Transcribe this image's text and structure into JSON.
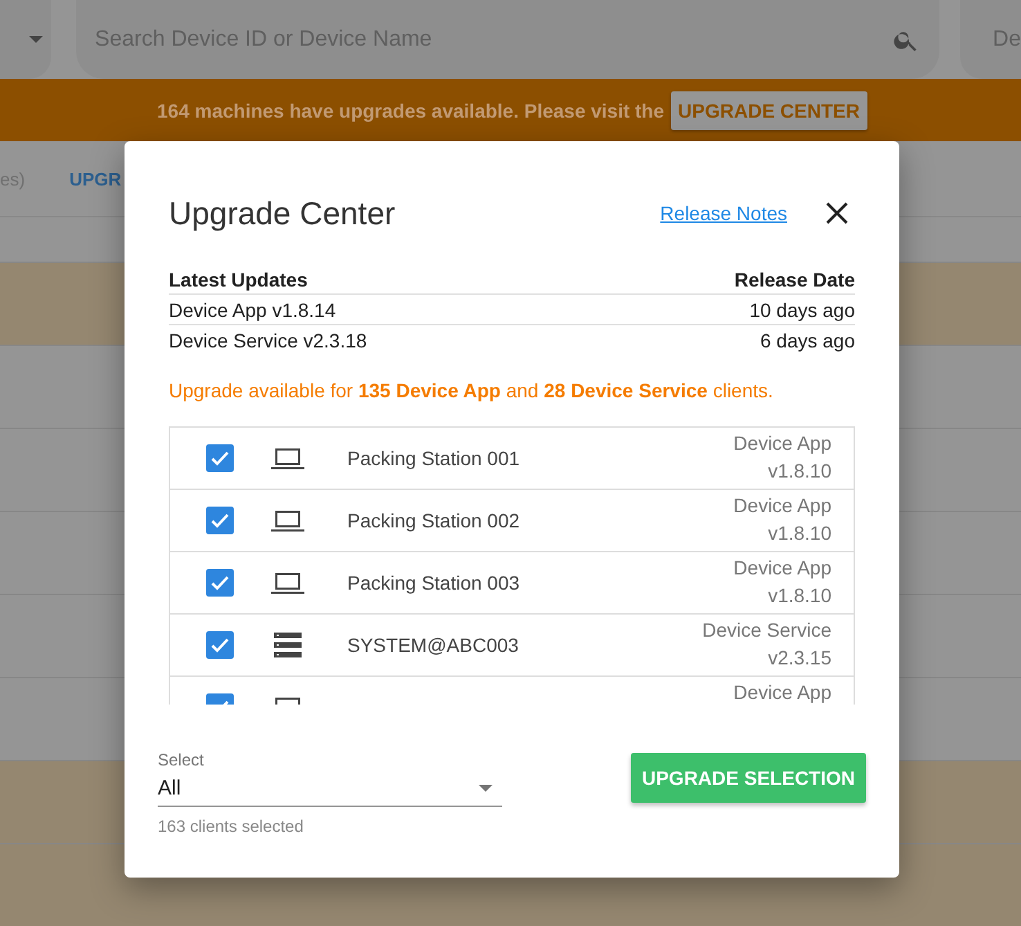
{
  "top_bar": {
    "search": {
      "placeholder": "Search Device ID or Device Name"
    },
    "right_field_text": "De"
  },
  "banner": {
    "message": "164 machines have upgrades available. Please visit the",
    "button": "UPGRADE CENTER"
  },
  "background_tabs": [
    {
      "label": "es)",
      "selected": false
    },
    {
      "label": "UPGR",
      "selected": true
    }
  ],
  "background_rows": [
    {
      "highlighted": false
    },
    {
      "highlighted": true
    },
    {
      "highlighted": false
    },
    {
      "highlighted": false
    },
    {
      "highlighted": false
    },
    {
      "highlighted": false
    },
    {
      "highlighted": false
    },
    {
      "highlighted": true
    },
    {
      "highlighted": true
    }
  ],
  "dialog": {
    "title": "Upgrade Center",
    "link": "Release Notes",
    "updates": {
      "columns": [
        "Latest Updates",
        "Release Date"
      ],
      "rows": [
        [
          "Device App v1.8.14",
          "10 days ago"
        ],
        [
          "Device Service v2.3.18",
          "6 days ago"
        ]
      ]
    },
    "notice": "Upgrade available for **135 Device App** and **28 Device Service** clients.",
    "clients": [
      {
        "checked": true,
        "kind": "laptop",
        "name": "Packing Station 001",
        "type": "Device App",
        "version": "v1.8.10"
      },
      {
        "checked": true,
        "kind": "laptop",
        "name": "Packing Station 002",
        "type": "Device App",
        "version": "v1.8.10"
      },
      {
        "checked": true,
        "kind": "laptop",
        "name": "Packing Station 003",
        "type": "Device App",
        "version": "v1.8.10"
      },
      {
        "checked": true,
        "kind": "server",
        "name": "SYSTEM@ABC003",
        "type": "Device Service",
        "version": "v2.3.15"
      },
      {
        "checked": true,
        "kind": "laptop",
        "type": "Device App"
      }
    ],
    "select": {
      "label": "Select",
      "value": "All",
      "helper": "163 clients selected"
    },
    "button": "UPGRADE SELECTION"
  }
}
